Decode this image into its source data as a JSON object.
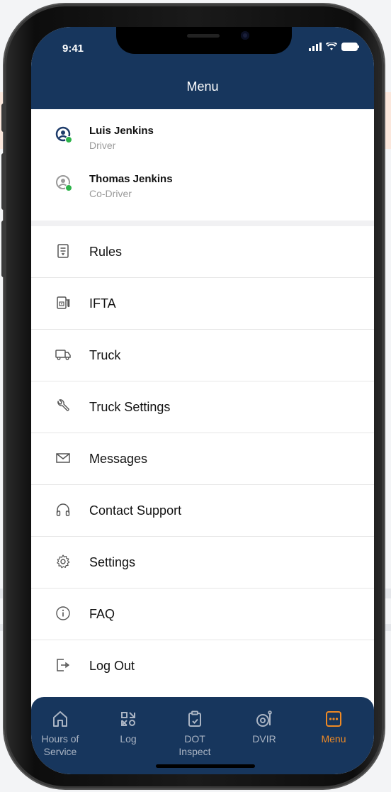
{
  "status_bar": {
    "time": "9:41"
  },
  "header": {
    "title": "Menu"
  },
  "users": [
    {
      "name": "Luis Jenkins",
      "role": "Driver",
      "icon": "user-circle-icon",
      "active": true
    },
    {
      "name": "Thomas Jenkins",
      "role": "Co-Driver",
      "icon": "user-circle-icon",
      "active": false
    }
  ],
  "menu_items": [
    {
      "label": "Rules",
      "icon": "document-icon"
    },
    {
      "label": "IFTA",
      "icon": "fuel-icon"
    },
    {
      "label": "Truck",
      "icon": "truck-icon"
    },
    {
      "label": "Truck Settings",
      "icon": "wrench-icon"
    },
    {
      "label": "Messages",
      "icon": "envelope-icon"
    },
    {
      "label": "Contact Support",
      "icon": "headphones-icon"
    },
    {
      "label": "Settings",
      "icon": "gear-icon"
    },
    {
      "label": "FAQ",
      "icon": "info-icon"
    },
    {
      "label": "Log Out",
      "icon": "logout-icon"
    }
  ],
  "tabs": [
    {
      "label_line1": "Hours of",
      "label_line2": "Service",
      "icon": "home-icon",
      "active": false
    },
    {
      "label_line1": "Log",
      "label_line2": "",
      "icon": "qr-icon",
      "active": false
    },
    {
      "label_line1": "DOT",
      "label_line2": "Inspect",
      "icon": "clipboard-icon",
      "active": false
    },
    {
      "label_line1": "DVIR",
      "label_line2": "",
      "icon": "tire-icon",
      "active": false
    },
    {
      "label_line1": "Menu",
      "label_line2": "",
      "icon": "menu-icon",
      "active": true
    }
  ],
  "colors": {
    "header": "#17365d",
    "accent": "#f08a24",
    "online": "#2db34a"
  }
}
